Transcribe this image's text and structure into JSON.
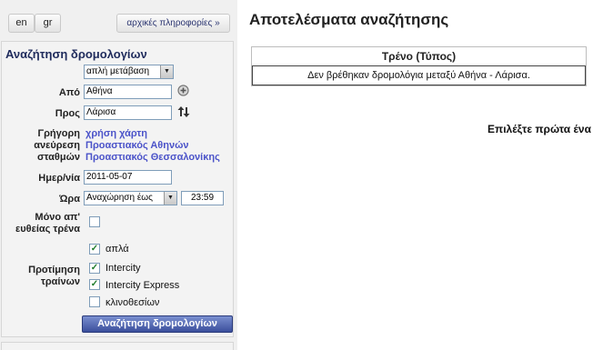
{
  "nav": {
    "lang_en": "en",
    "lang_gr": "gr",
    "start_info": "αρχικές πληροφορίες »"
  },
  "search": {
    "title": "Αναζήτηση δρομολογίων",
    "trip_type": "απλή μετάβαση",
    "from_label": "Από",
    "from_value": "Αθήνα",
    "to_label": "Προς",
    "to_value": "Λάρισα",
    "quick_find_label": [
      "Γρήγορη",
      "ανεύρεση",
      "σταθμών"
    ],
    "map_links": [
      "χρήση χάρτη",
      "Προαστιακός Αθηνών",
      "Προαστιακός Θεσσαλονίκης"
    ],
    "date_label": "Ημερ/νία",
    "date_value": "2011-05-07",
    "time_label": "Ώρα",
    "time_mode": "Αναχώρηση έως",
    "time_value": "23:59",
    "direct_label": [
      "Μόνο απ'",
      "ευθείας τρένα"
    ],
    "direct_checked": false,
    "train_pref_label": [
      "Προτίμηση",
      "τραίνων"
    ],
    "train_types": [
      {
        "label": "απλά",
        "checked": true
      },
      {
        "label": "Intercity",
        "checked": true
      },
      {
        "label": "Intercity Express",
        "checked": true
      },
      {
        "label": "κλινοθεσίων",
        "checked": false
      }
    ],
    "button": "Αναζήτηση δρομολογίων"
  },
  "results": {
    "title": "Αποτελέσματα αναζήτησης",
    "column_header": "Τρένο (Τύπος)",
    "message": "Δεν βρέθηκαν δρομολόγια μεταξύ Αθήνα - Λάρισα.",
    "select_first": "Επιλέξτε πρώτα ένα"
  },
  "icons": {
    "add_station": "plus-circle-icon",
    "swap": "swap-arrows-icon"
  },
  "colors": {
    "link": "#4b53c9",
    "button": "#3b4f9c",
    "title": "#1f2b5c"
  }
}
